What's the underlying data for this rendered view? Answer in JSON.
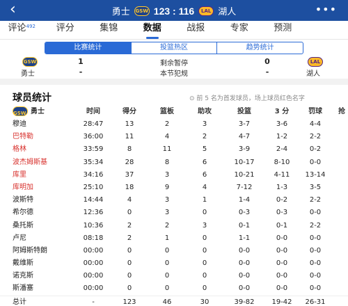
{
  "header": {
    "home_team": "勇士",
    "home_logo_text": "GSW",
    "score": "123 : 116",
    "away_logo_text": "LAL",
    "away_team": "湖人",
    "back_icon": "chevron-left-icon",
    "more_icon": "more-dots-icon",
    "bar_color": "#1d4fa0"
  },
  "nav": {
    "tabs": [
      {
        "label": "评论",
        "badge": "492"
      },
      {
        "label": "评分",
        "badge": ""
      },
      {
        "label": "集锦",
        "badge": ""
      },
      {
        "label": "数据",
        "badge": ""
      },
      {
        "label": "战报",
        "badge": ""
      },
      {
        "label": "专家",
        "badge": ""
      },
      {
        "label": "预测",
        "badge": ""
      }
    ],
    "active": "数据"
  },
  "segments": {
    "items": [
      "比赛统计",
      "投篮热区",
      "趋势统计"
    ],
    "active": "比赛统计",
    "accent": "#2a6ad6"
  },
  "summary": {
    "home_logo_text": "GSW",
    "away_logo_text": "LAL",
    "home_name": "勇士",
    "away_name": "湖人",
    "timeouts_label": "剩余暂停",
    "home_timeouts": "1",
    "away_timeouts": "0",
    "fouls_label": "本节犯规",
    "home_fouls": "-",
    "away_fouls": "-"
  },
  "player_stats": {
    "title": "球员统计",
    "note": "⊙ 前 5 名为首发球员，场上球员红色名字",
    "team_label": "勇士",
    "team_logo_text": "GSW",
    "columns": [
      "时间",
      "得分",
      "篮板",
      "助攻",
      "投篮",
      "3 分",
      "罚球",
      "抢"
    ],
    "rows": [
      {
        "name": "穆迪",
        "red": false,
        "cells": [
          "28:47",
          "13",
          "2",
          "3",
          "3-7",
          "3-6",
          "4-4"
        ]
      },
      {
        "name": "巴特勒",
        "red": true,
        "cells": [
          "36:00",
          "11",
          "4",
          "2",
          "4-7",
          "1-2",
          "2-2"
        ]
      },
      {
        "name": "格林",
        "red": true,
        "cells": [
          "33:59",
          "8",
          "11",
          "5",
          "3-9",
          "2-4",
          "0-2"
        ]
      },
      {
        "name": "波杰姆斯基",
        "red": true,
        "cells": [
          "35:34",
          "28",
          "8",
          "6",
          "10-17",
          "8-10",
          "0-0"
        ]
      },
      {
        "name": "库里",
        "red": true,
        "cells": [
          "34:16",
          "37",
          "3",
          "6",
          "10-21",
          "4-11",
          "13-14"
        ]
      },
      {
        "name": "库明加",
        "red": true,
        "cells": [
          "25:10",
          "18",
          "9",
          "4",
          "7-12",
          "1-3",
          "3-5"
        ]
      },
      {
        "name": "波斯特",
        "red": false,
        "cells": [
          "14:44",
          "4",
          "3",
          "1",
          "1-4",
          "0-2",
          "2-2"
        ]
      },
      {
        "name": "希尔德",
        "red": false,
        "cells": [
          "12:36",
          "0",
          "3",
          "0",
          "0-3",
          "0-3",
          "0-0"
        ]
      },
      {
        "name": "桑托斯",
        "red": false,
        "cells": [
          "10:36",
          "2",
          "2",
          "3",
          "0-1",
          "0-1",
          "2-2"
        ]
      },
      {
        "name": "卢尼",
        "red": false,
        "cells": [
          "08:18",
          "2",
          "1",
          "0",
          "1-1",
          "0-0",
          "0-0"
        ]
      },
      {
        "name": "阿姆斯特朗",
        "red": false,
        "cells": [
          "00:00",
          "0",
          "0",
          "0",
          "0-0",
          "0-0",
          "0-0"
        ]
      },
      {
        "name": "戴维斯",
        "red": false,
        "cells": [
          "00:00",
          "0",
          "0",
          "0",
          "0-0",
          "0-0",
          "0-0"
        ]
      },
      {
        "name": "诺克斯",
        "red": false,
        "cells": [
          "00:00",
          "0",
          "0",
          "0",
          "0-0",
          "0-0",
          "0-0"
        ]
      },
      {
        "name": "斯潘塞",
        "red": false,
        "cells": [
          "00:00",
          "0",
          "0",
          "0",
          "0-0",
          "0-0",
          "0-0"
        ]
      }
    ],
    "total": {
      "name": "总计",
      "cells": [
        "-",
        "123",
        "46",
        "30",
        "39-82",
        "19-42",
        "26-31"
      ]
    },
    "red_color": "#d8322e"
  }
}
